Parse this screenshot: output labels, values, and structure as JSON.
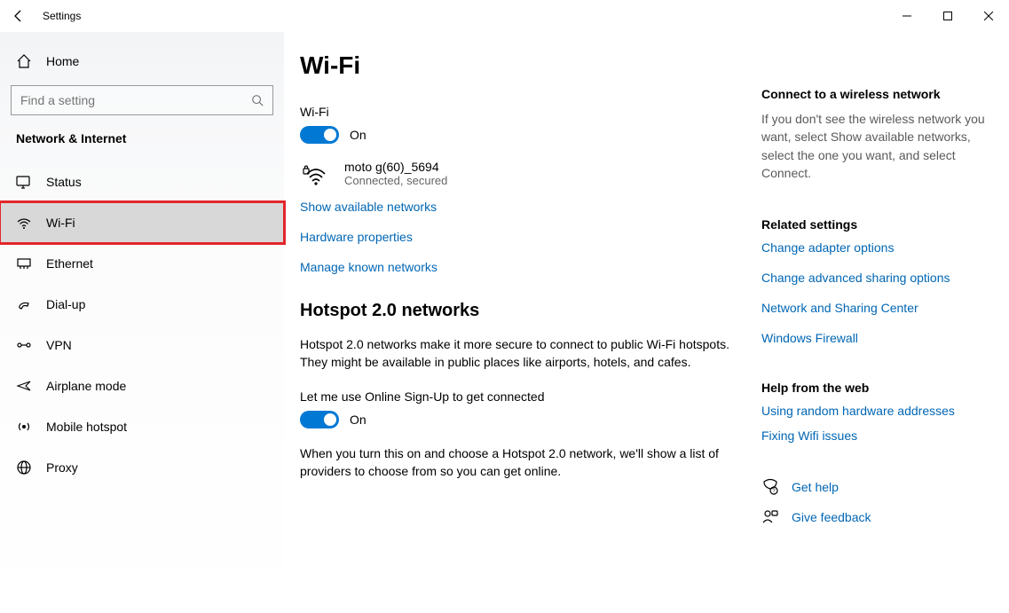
{
  "titlebar": {
    "title": "Settings"
  },
  "sidebar": {
    "home": "Home",
    "search_placeholder": "Find a setting",
    "section": "Network & Internet",
    "items": [
      {
        "label": "Status",
        "icon": "status-icon"
      },
      {
        "label": "Wi-Fi",
        "icon": "wifi-icon",
        "active": true,
        "highlighted": true
      },
      {
        "label": "Ethernet",
        "icon": "ethernet-icon"
      },
      {
        "label": "Dial-up",
        "icon": "dialup-icon"
      },
      {
        "label": "VPN",
        "icon": "vpn-icon"
      },
      {
        "label": "Airplane mode",
        "icon": "airplane-icon"
      },
      {
        "label": "Mobile hotspot",
        "icon": "hotspot-icon"
      },
      {
        "label": "Proxy",
        "icon": "proxy-icon"
      }
    ]
  },
  "main": {
    "title": "Wi-Fi",
    "wifi_label": "Wi-Fi",
    "wifi_state": "On",
    "network": {
      "name": "moto g(60)_5694",
      "status": "Connected, secured"
    },
    "links": {
      "show_available": "Show available networks",
      "hw_props": "Hardware properties",
      "manage_known": "Manage known networks"
    },
    "hotspot": {
      "heading": "Hotspot 2.0 networks",
      "intro": "Hotspot 2.0 networks make it more secure to connect to public Wi-Fi hotspots. They might be available in public places like airports, hotels, and cafes.",
      "toggle_label": "Let me use Online Sign-Up to get connected",
      "toggle_state": "On",
      "desc": "When you turn this on and choose a Hotspot 2.0 network, we'll show a list of providers to choose from so you can get online."
    }
  },
  "aside": {
    "connect_title": "Connect to a wireless network",
    "connect_text": "If you don't see the wireless network you want, select Show available networks, select the one you want, and select Connect.",
    "related_title": "Related settings",
    "related_links": [
      "Change adapter options",
      "Change advanced sharing options",
      "Network and Sharing Center",
      "Windows Firewall"
    ],
    "help_title": "Help from the web",
    "help_links": [
      "Using random hardware addresses",
      "Fixing Wifi issues"
    ],
    "get_help": "Get help",
    "give_feedback": "Give feedback"
  }
}
